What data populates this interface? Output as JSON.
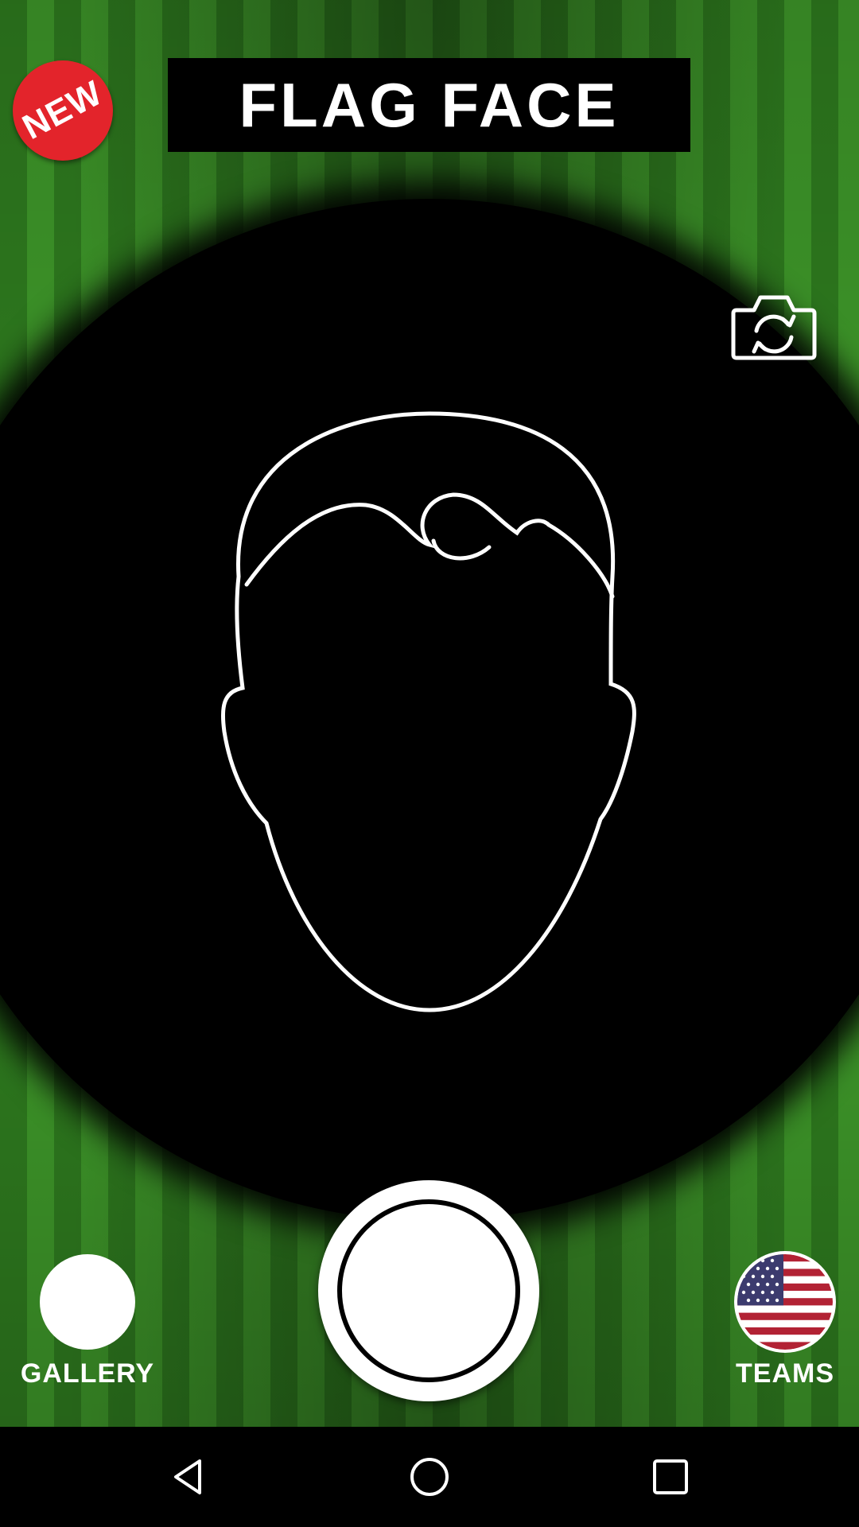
{
  "badge": {
    "text": "NEW",
    "color": "#e3242b"
  },
  "header": {
    "title": "FLAG FACE"
  },
  "camera": {
    "switch_icon": "camera-switch-icon",
    "guide": "face-outline"
  },
  "bottom_bar": {
    "gallery_label": "GALLERY",
    "teams_label": "TEAMS",
    "teams_flag": "usa-flag-icon"
  },
  "navbar": {
    "icons": [
      "back-icon",
      "home-icon",
      "recent-apps-icon"
    ]
  },
  "colors": {
    "grass_dark": "#2f7d1f",
    "grass_light": "#3f9a2a",
    "flag_red": "#b22234",
    "flag_blue": "#3c3b6e"
  }
}
